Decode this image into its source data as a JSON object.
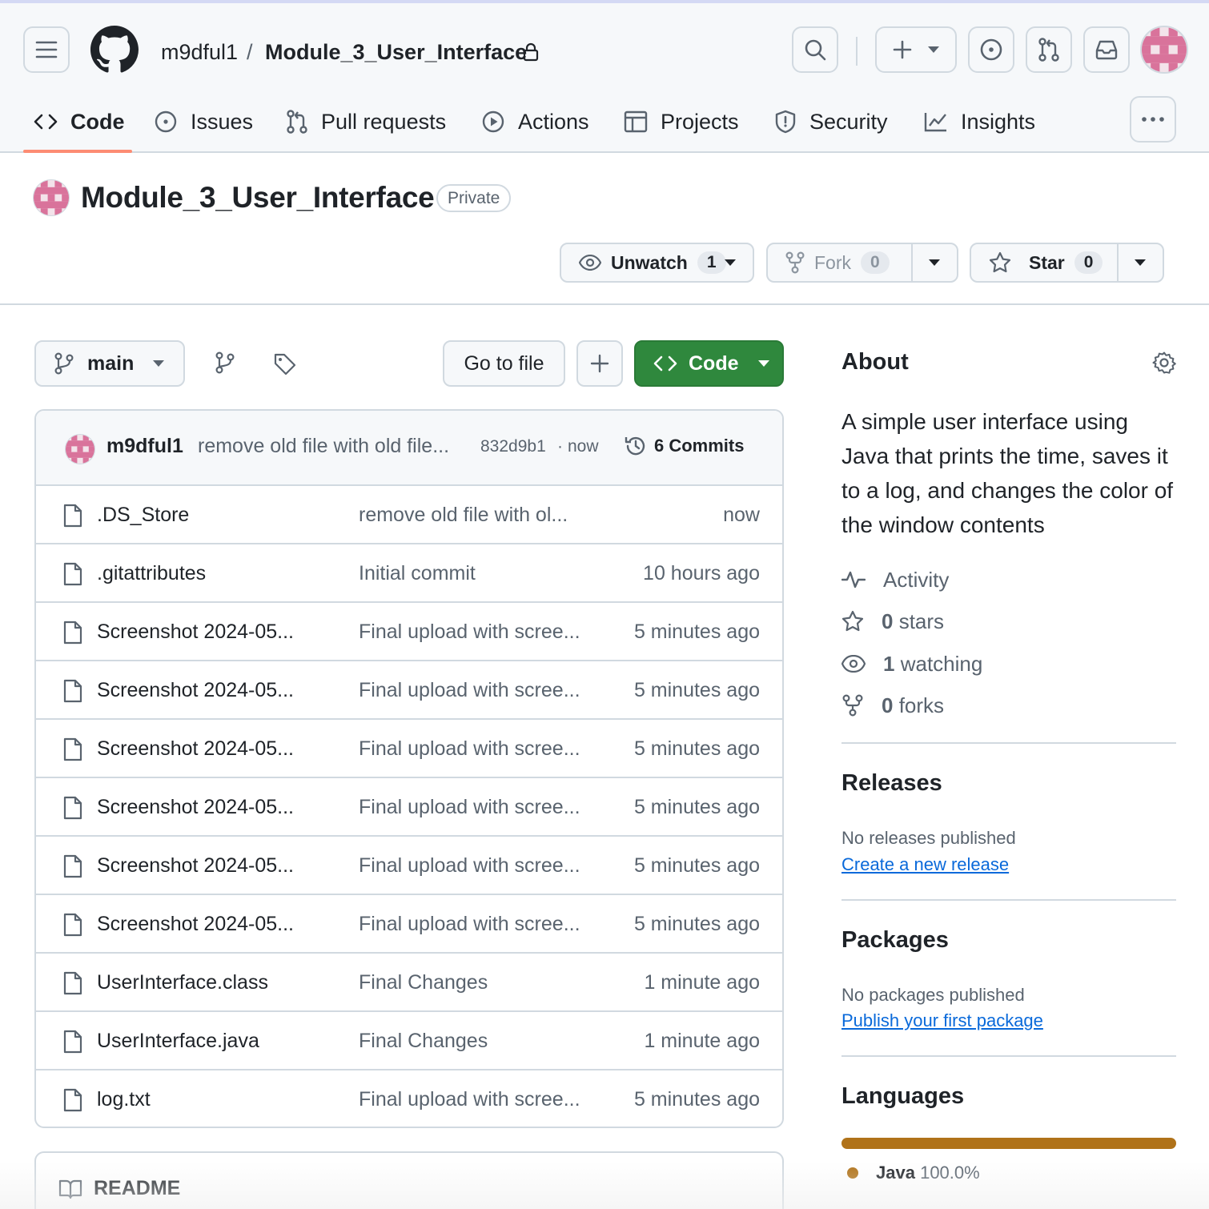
{
  "header": {
    "owner": "m9dful1",
    "separator": "/",
    "repo": "Module_3_User_Interface"
  },
  "tabs": [
    {
      "label": "Code",
      "icon": "code-icon"
    },
    {
      "label": "Issues",
      "icon": "issue-opened-icon"
    },
    {
      "label": "Pull requests",
      "icon": "git-pull-request-icon"
    },
    {
      "label": "Actions",
      "icon": "play-icon"
    },
    {
      "label": "Projects",
      "icon": "table-icon"
    },
    {
      "label": "Security",
      "icon": "shield-icon"
    },
    {
      "label": "Insights",
      "icon": "graph-icon"
    }
  ],
  "repo": {
    "title": "Module_3_User_Interface",
    "visibility": "Private",
    "unwatch_label": "Unwatch",
    "watch_count": "1",
    "fork_label": "Fork",
    "fork_count": "0",
    "star_label": "Star",
    "star_count": "0"
  },
  "filenav": {
    "branch": "main",
    "go_to_file": "Go to file",
    "code_label": "Code"
  },
  "commit": {
    "author": "m9dful1",
    "message": "remove old file with old file...",
    "hash": "832d9b1",
    "dot": "·",
    "time": "now",
    "commits_label": "6 Commits"
  },
  "files": [
    {
      "name": ".DS_Store",
      "message": "remove old file with ol...",
      "time": "now"
    },
    {
      "name": ".gitattributes",
      "message": "Initial commit",
      "time": "10 hours ago"
    },
    {
      "name": "Screenshot 2024-05...",
      "message": "Final upload with scree...",
      "time": "5 minutes ago"
    },
    {
      "name": "Screenshot 2024-05...",
      "message": "Final upload with scree...",
      "time": "5 minutes ago"
    },
    {
      "name": "Screenshot 2024-05...",
      "message": "Final upload with scree...",
      "time": "5 minutes ago"
    },
    {
      "name": "Screenshot 2024-05...",
      "message": "Final upload with scree...",
      "time": "5 minutes ago"
    },
    {
      "name": "Screenshot 2024-05...",
      "message": "Final upload with scree...",
      "time": "5 minutes ago"
    },
    {
      "name": "Screenshot 2024-05...",
      "message": "Final upload with scree...",
      "time": "5 minutes ago"
    },
    {
      "name": "UserInterface.class",
      "message": "Final Changes",
      "time": "1 minute ago"
    },
    {
      "name": "UserInterface.java",
      "message": "Final Changes",
      "time": "1 minute ago"
    },
    {
      "name": "log.txt",
      "message": "Final upload with scree...",
      "time": "5 minutes ago"
    }
  ],
  "readme": {
    "label": "README"
  },
  "about": {
    "heading": "About",
    "description": "A simple user interface using Java that prints the time, saves it to a log, and changes the color of the window contents",
    "activity": "Activity",
    "stars_count": "0",
    "stars_label": "stars",
    "watching_count": "1",
    "watching_label": "watching",
    "forks_count": "0",
    "forks_label": "forks"
  },
  "releases": {
    "heading": "Releases",
    "none": "No releases published",
    "link": "Create a new release"
  },
  "packages": {
    "heading": "Packages",
    "none": "No packages published",
    "link": "Publish your first package"
  },
  "languages": {
    "heading": "Languages",
    "items": [
      {
        "name": "Java",
        "percent": "100.0%",
        "share": 1.0,
        "color": "#b07219"
      }
    ]
  },
  "colors": {
    "accent_underline": "#fd8c73",
    "green_button": "#2f883d",
    "link": "#0969da",
    "java": "#b07219",
    "avatar_pink": "#d9739b"
  }
}
